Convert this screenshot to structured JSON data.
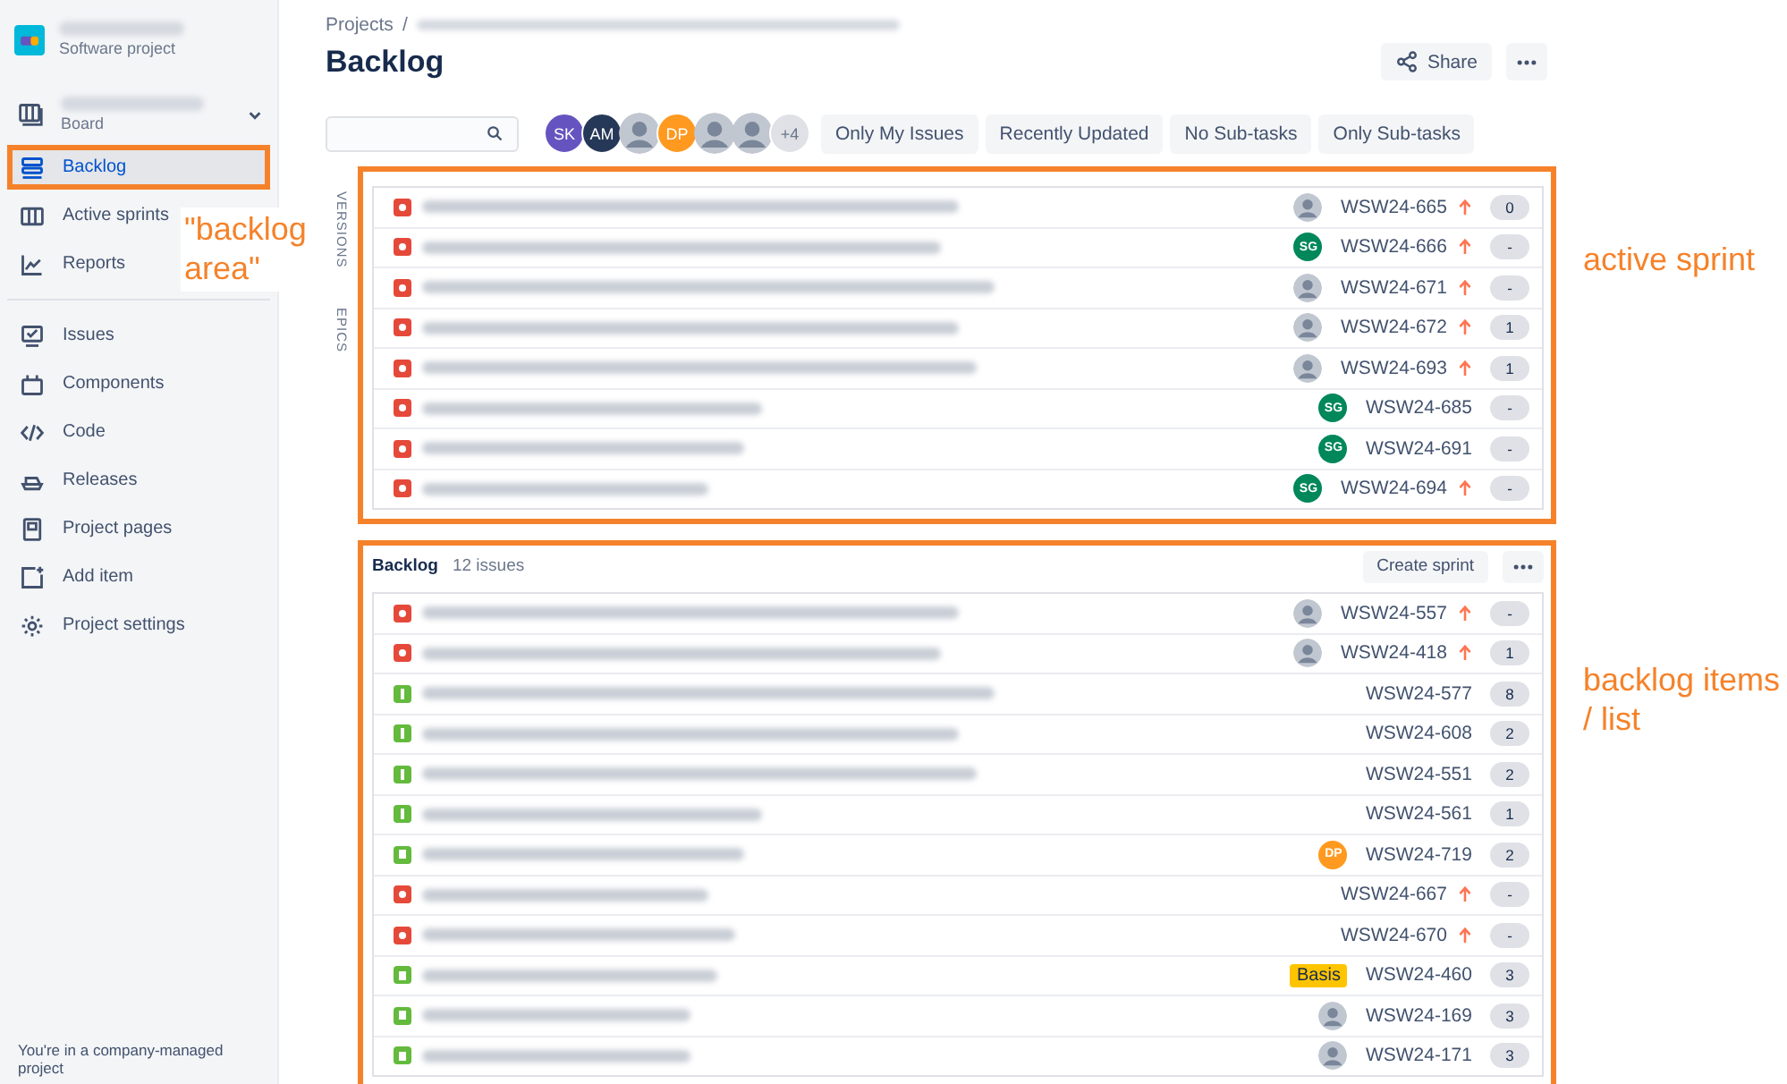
{
  "sidebar": {
    "project": {
      "type": "Software project"
    },
    "board": {
      "label": "Board"
    },
    "items": [
      {
        "label": "Backlog",
        "selected": true,
        "annotated": true
      },
      {
        "label": "Active sprints",
        "selected": false,
        "annotated": false
      },
      {
        "label": "Reports",
        "selected": false,
        "annotated": false
      }
    ],
    "items2": [
      {
        "label": "Issues",
        "selected": false
      },
      {
        "label": "Components",
        "selected": false
      },
      {
        "label": "Code",
        "selected": false
      },
      {
        "label": "Releases",
        "selected": false
      },
      {
        "label": "Project pages",
        "selected": false
      },
      {
        "label": "Add item",
        "selected": false
      },
      {
        "label": "Project settings",
        "selected": false
      }
    ],
    "footer": "You're in a company-managed project"
  },
  "breadcrumb": {
    "root": "Projects",
    "separator": "/"
  },
  "title": "Backlog",
  "actions": {
    "share": "Share"
  },
  "filters": {
    "avatars": [
      {
        "kind": "initials",
        "text": "SK",
        "color": "#6554c0"
      },
      {
        "kind": "initials",
        "text": "AM",
        "color": "#253858"
      },
      {
        "kind": "photo"
      },
      {
        "kind": "initials",
        "text": "DP",
        "color": "#ff991f"
      },
      {
        "kind": "photo"
      },
      {
        "kind": "photo"
      }
    ],
    "more": "+4",
    "quick": [
      "Only My Issues",
      "Recently Updated",
      "No Sub-tasks",
      "Only Sub-tasks"
    ]
  },
  "side_tabs": [
    "VERSIONS",
    "EPICS"
  ],
  "sprint": {
    "annotated": true,
    "rows": [
      {
        "kind": "bug",
        "assignee": {
          "kind": "photo"
        },
        "key": "WSW24-665",
        "high_priority": true,
        "estimate": "0"
      },
      {
        "kind": "bug",
        "assignee": {
          "kind": "initials",
          "text": "SG",
          "color": "#00875a"
        },
        "key": "WSW24-666",
        "high_priority": true,
        "estimate": "-"
      },
      {
        "kind": "bug",
        "assignee": {
          "kind": "photo"
        },
        "key": "WSW24-671",
        "high_priority": true,
        "estimate": "-"
      },
      {
        "kind": "bug",
        "assignee": {
          "kind": "photo"
        },
        "key": "WSW24-672",
        "high_priority": true,
        "estimate": "1"
      },
      {
        "kind": "bug",
        "assignee": {
          "kind": "photo"
        },
        "key": "WSW24-693",
        "high_priority": true,
        "estimate": "1"
      },
      {
        "kind": "bug",
        "assignee": {
          "kind": "initials",
          "text": "SG",
          "color": "#00875a"
        },
        "key": "WSW24-685",
        "high_priority": false,
        "estimate": "-"
      },
      {
        "kind": "bug",
        "assignee": {
          "kind": "initials",
          "text": "SG",
          "color": "#00875a"
        },
        "key": "WSW24-691",
        "high_priority": false,
        "estimate": "-"
      },
      {
        "kind": "bug",
        "assignee": {
          "kind": "initials",
          "text": "SG",
          "color": "#00875a"
        },
        "key": "WSW24-694",
        "high_priority": true,
        "estimate": "-"
      }
    ]
  },
  "backlog": {
    "annotated": true,
    "title": "Backlog",
    "count": "12 issues",
    "create": "Create sprint",
    "rows": [
      {
        "kind": "bug",
        "assignee": {
          "kind": "photo"
        },
        "key": "WSW24-557",
        "high_priority": true,
        "estimate": "-"
      },
      {
        "kind": "bug",
        "assignee": {
          "kind": "photo"
        },
        "key": "WSW24-418",
        "high_priority": true,
        "estimate": "1"
      },
      {
        "kind": "task",
        "key": "WSW24-577",
        "high_priority": false,
        "estimate": "8"
      },
      {
        "kind": "task",
        "key": "WSW24-608",
        "high_priority": false,
        "estimate": "2"
      },
      {
        "kind": "task",
        "key": "WSW24-551",
        "high_priority": false,
        "estimate": "2"
      },
      {
        "kind": "task",
        "key": "WSW24-561",
        "high_priority": false,
        "estimate": "1"
      },
      {
        "kind": "story",
        "assignee": {
          "kind": "initials",
          "text": "DP",
          "color": "#ff991f"
        },
        "key": "WSW24-719",
        "high_priority": false,
        "estimate": "2"
      },
      {
        "kind": "bug",
        "key": "WSW24-667",
        "high_priority": true,
        "estimate": "-"
      },
      {
        "kind": "bug",
        "key": "WSW24-670",
        "high_priority": true,
        "estimate": "-"
      },
      {
        "kind": "story",
        "label": "Basis",
        "key": "WSW24-460",
        "high_priority": false,
        "estimate": "3"
      },
      {
        "kind": "story",
        "assignee": {
          "kind": "photo"
        },
        "key": "WSW24-169",
        "high_priority": false,
        "estimate": "3"
      },
      {
        "kind": "story",
        "assignee": {
          "kind": "photo"
        },
        "key": "WSW24-171",
        "high_priority": false,
        "estimate": "3"
      }
    ]
  },
  "annotations": {
    "sidebar": "\"backlog area\"",
    "sprint": "active sprint",
    "backlog": "backlog items / list"
  }
}
